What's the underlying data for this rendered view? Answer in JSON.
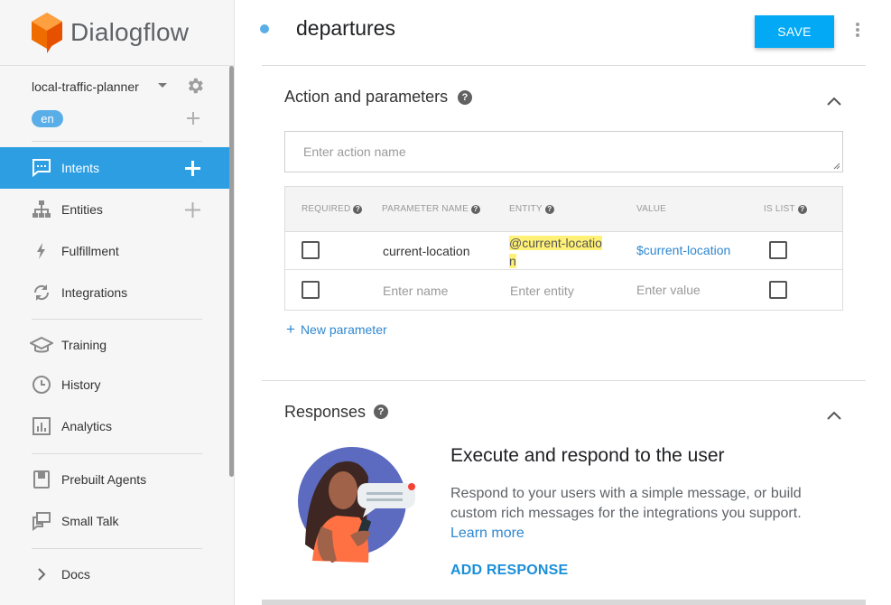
{
  "app": {
    "name": "Dialogflow"
  },
  "agent": {
    "name": "local-traffic-planner",
    "language": "en"
  },
  "sidebar": {
    "items": [
      {
        "label": "Intents",
        "icon": "chat-icon",
        "active": true,
        "plus": true
      },
      {
        "label": "Entities",
        "icon": "hierarchy-icon",
        "plus": true
      },
      {
        "label": "Fulfillment",
        "icon": "bolt-icon"
      },
      {
        "label": "Integrations",
        "icon": "refresh-icon"
      },
      {
        "label": "Training",
        "icon": "graduation-cap-icon"
      },
      {
        "label": "History",
        "icon": "clock-icon"
      },
      {
        "label": "Analytics",
        "icon": "bar-chart-icon"
      },
      {
        "label": "Prebuilt Agents",
        "icon": "book-icon"
      },
      {
        "label": "Small Talk",
        "icon": "chat-bubbles-icon"
      },
      {
        "label": "Docs",
        "icon": "chevron-right-icon"
      }
    ]
  },
  "header": {
    "intent_name": "departures",
    "save_label": "SAVE"
  },
  "action_section": {
    "title": "Action and parameters",
    "action_placeholder": "Enter action name",
    "columns": [
      "REQUIRED",
      "PARAMETER NAME",
      "ENTITY",
      "VALUE",
      "IS LIST"
    ],
    "rows": [
      {
        "name": "current-location",
        "entity_line1": "@current-locatio",
        "entity_line2": "n",
        "value": "$current-location"
      }
    ],
    "empty_row": {
      "name": "Enter name",
      "entity": "Enter entity",
      "value": "Enter value"
    },
    "new_parameter": "New parameter"
  },
  "responses_section": {
    "title": "Responses",
    "heading": "Execute and respond to the user",
    "description": "Respond to your users with a simple message, or build custom rich messages for the integrations you support.",
    "learn_more": "Learn more",
    "add_response": "ADD RESPONSE"
  },
  "colors": {
    "accent": "#2e9ee3",
    "save": "#03a9f4",
    "link": "#2f87cf",
    "highlight": "#fff176"
  }
}
